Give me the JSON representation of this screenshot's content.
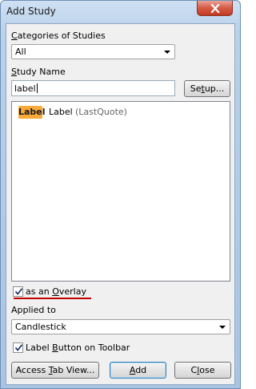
{
  "window": {
    "title": "Add Study"
  },
  "categories": {
    "label_u": "C",
    "label_rest": "ategories of Studies",
    "selected": "All"
  },
  "study_name": {
    "label_u": "S",
    "label_rest": "tudy Name",
    "value": "label"
  },
  "setup_button": {
    "label_pre": "Se",
    "label_u": "t",
    "label_post": "up..."
  },
  "study_list": [
    {
      "badge": "Label",
      "name": "Label",
      "source": "(LastQuote)"
    }
  ],
  "overlay": {
    "checked": true,
    "label_pre": "as an ",
    "label_u": "O",
    "label_post": "verlay"
  },
  "applied_to": {
    "label": "Applied to",
    "selected": "Candlestick"
  },
  "toolbar_button": {
    "checked": true,
    "label_pre": "Label ",
    "label_u": "B",
    "label_post": "utton on Toolbar"
  },
  "buttons": {
    "access_pre": "Access ",
    "access_u": "T",
    "access_post": "ab View...",
    "add_u": "A",
    "add_post": "dd",
    "close_pre": "C",
    "close_u": "l",
    "close_post": "ose"
  },
  "colors": {
    "badge": "#f7a93a",
    "overlay_underline": "#c00000",
    "close_button": "#c23b23"
  }
}
